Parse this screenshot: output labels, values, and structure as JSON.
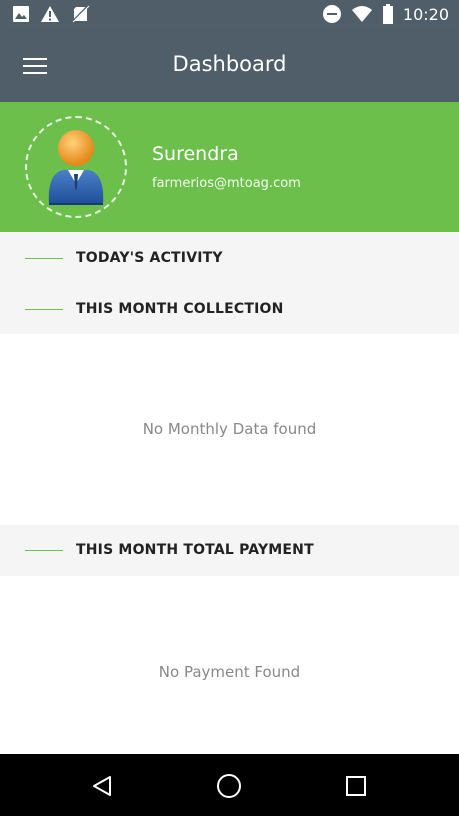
{
  "status_bar": {
    "time": "10:20",
    "left_icons": [
      "image-icon",
      "warning-icon",
      "no-sim-icon"
    ],
    "right_icons": [
      "do-not-disturb-icon",
      "wifi-icon",
      "battery-icon"
    ]
  },
  "toolbar": {
    "title": "Dashboard",
    "menu_icon": "hamburger-menu-icon"
  },
  "profile": {
    "name": "Surendra",
    "email": "farmerios@mtoag.com",
    "avatar_icon": "user-avatar-icon"
  },
  "sections": {
    "today_activity": "TODAY'S ACTIVITY",
    "month_collection": "THIS MONTH COLLECTION",
    "month_payment": "THIS MONTH TOTAL PAYMENT"
  },
  "empty_states": {
    "monthly": "No Monthly Data found",
    "payment": "No Payment Found"
  },
  "nav": {
    "back_icon": "back-triangle-icon",
    "home_icon": "home-circle-icon",
    "recents_icon": "recents-square-icon"
  },
  "colors": {
    "toolbar": "#4f5e69",
    "accent_green": "#6cbf4a",
    "section_bg": "#f5f5f5"
  }
}
